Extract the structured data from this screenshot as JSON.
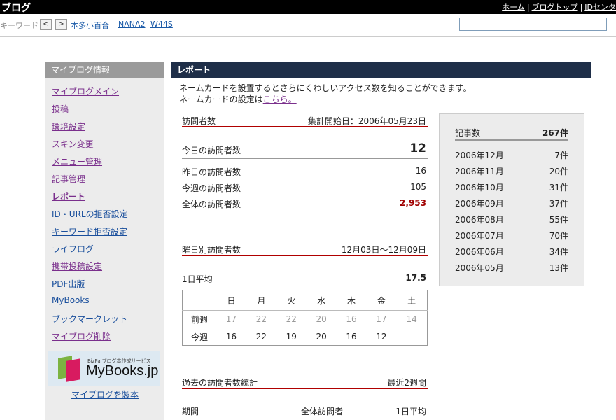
{
  "topbar": {
    "brand": "ブログ",
    "links": [
      "ホーム",
      "ブログトップ",
      "IDセンタ"
    ]
  },
  "kwrow": {
    "label": "キーワード",
    "prev": "<",
    "next": ">",
    "keywords": [
      "本多小百合",
      "NANA2",
      "W44S"
    ],
    "search_value": ""
  },
  "sidebar": {
    "title": "マイブログ情報",
    "items": [
      "マイブログメイン",
      "投稿",
      "環境設定",
      "スキン変更",
      "メニュー管理",
      "記事管理",
      "レポート",
      "ID・URLの拒否設定",
      "キーワード拒否設定",
      "ライフログ",
      "携帯投稿設定",
      "PDF出版",
      "MyBooks",
      "ブックマークレット",
      "マイブログ削除"
    ],
    "active_item": "レポート",
    "banner_small": "BizPalブログ本作成サービス",
    "banner_big": "MyBooks.jp",
    "bind_link": "マイブログを製本"
  },
  "main": {
    "title": "レポート",
    "intro_line1": "ネームカードを設置するとさらにくわしいアクセス数を知ることができます。",
    "intro_line2_prefix": "ネームカードの設定は",
    "intro_line2_link": "こちら。",
    "visitors": {
      "title": "訪問者数",
      "since": "集計開始日：2006年05月23日",
      "today_label": "今日の訪問者数",
      "today_value": "12",
      "yesterday_label": "昨日の訪問者数",
      "yesterday_value": "16",
      "week_label": "今週の訪問者数",
      "week_value": "105",
      "total_label": "全体の訪問者数",
      "total_value": "2,953"
    },
    "weekday": {
      "title": "曜日別訪問者数",
      "range": "12月03日～12月09日",
      "avg_label": "1日平均",
      "avg_value": "17.5",
      "days": [
        "日",
        "月",
        "火",
        "水",
        "木",
        "金",
        "土"
      ],
      "prev_label": "前週",
      "prev_values": [
        "17",
        "22",
        "22",
        "20",
        "16",
        "17",
        "14"
      ],
      "cur_label": "今週",
      "cur_values": [
        "16",
        "22",
        "19",
        "20",
        "16",
        "12",
        "-"
      ]
    },
    "past": {
      "title": "過去の訪問者数統計",
      "range": "最近2週間",
      "col_period": "期間",
      "col_total": "全体訪問者",
      "col_avg": "1日平均"
    }
  },
  "articles": {
    "title": "記事数",
    "total": "267件",
    "rows": [
      {
        "month": "2006年12月",
        "count": "7件"
      },
      {
        "month": "2006年11月",
        "count": "20件"
      },
      {
        "month": "2006年10月",
        "count": "31件"
      },
      {
        "month": "2006年09月",
        "count": "37件"
      },
      {
        "month": "2006年08月",
        "count": "55件"
      },
      {
        "month": "2006年07月",
        "count": "70件"
      },
      {
        "month": "2006年06月",
        "count": "34件"
      },
      {
        "month": "2006年05月",
        "count": "13件"
      }
    ]
  }
}
